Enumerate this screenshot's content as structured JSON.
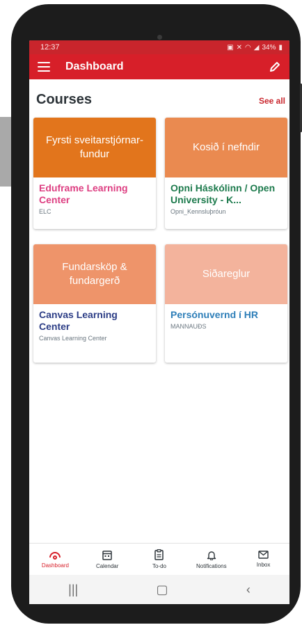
{
  "status": {
    "time": "12:37",
    "battery": "34%"
  },
  "appbar": {
    "title": "Dashboard"
  },
  "courses": {
    "title": "Courses",
    "see_all": "See all",
    "items": [
      {
        "image_text": "Fyrsti sveitarstjórnar-fundur",
        "name": "Eduframe Learning Center",
        "code": "ELC",
        "image_color": "#e2751c",
        "name_color": "#dd3e81"
      },
      {
        "image_text": "Kosið í nefndir",
        "name": "Opni Háskólinn / Open University - K...",
        "code": "Opni_Kennsluþróun",
        "image_color": "#ea8a50",
        "name_color": "#1c7a4c"
      },
      {
        "image_text": "Fundarsköp & fundargerð",
        "name": "Canvas Learning Center",
        "code": "Canvas Learning Center",
        "image_color": "#ee946a",
        "name_color": "#2b3c85"
      },
      {
        "image_text": "Siðareglur",
        "name": "Persónuvernd í HR",
        "code": "MANNAUÐS",
        "image_color": "#f3b39c",
        "name_color": "#2d7eb8"
      }
    ]
  },
  "bottom_nav": [
    {
      "label": "Dashboard",
      "icon": "dashboard-icon"
    },
    {
      "label": "Calendar",
      "icon": "calendar-icon"
    },
    {
      "label": "To-do",
      "icon": "todo-icon"
    },
    {
      "label": "Notifications",
      "icon": "bell-icon"
    },
    {
      "label": "Inbox",
      "icon": "envelope-icon"
    }
  ],
  "system_nav": {
    "recents": "|||",
    "home": "▢",
    "back": "‹"
  },
  "colors": {
    "brand": "#d71f29",
    "status_bar": "#c9252c"
  }
}
